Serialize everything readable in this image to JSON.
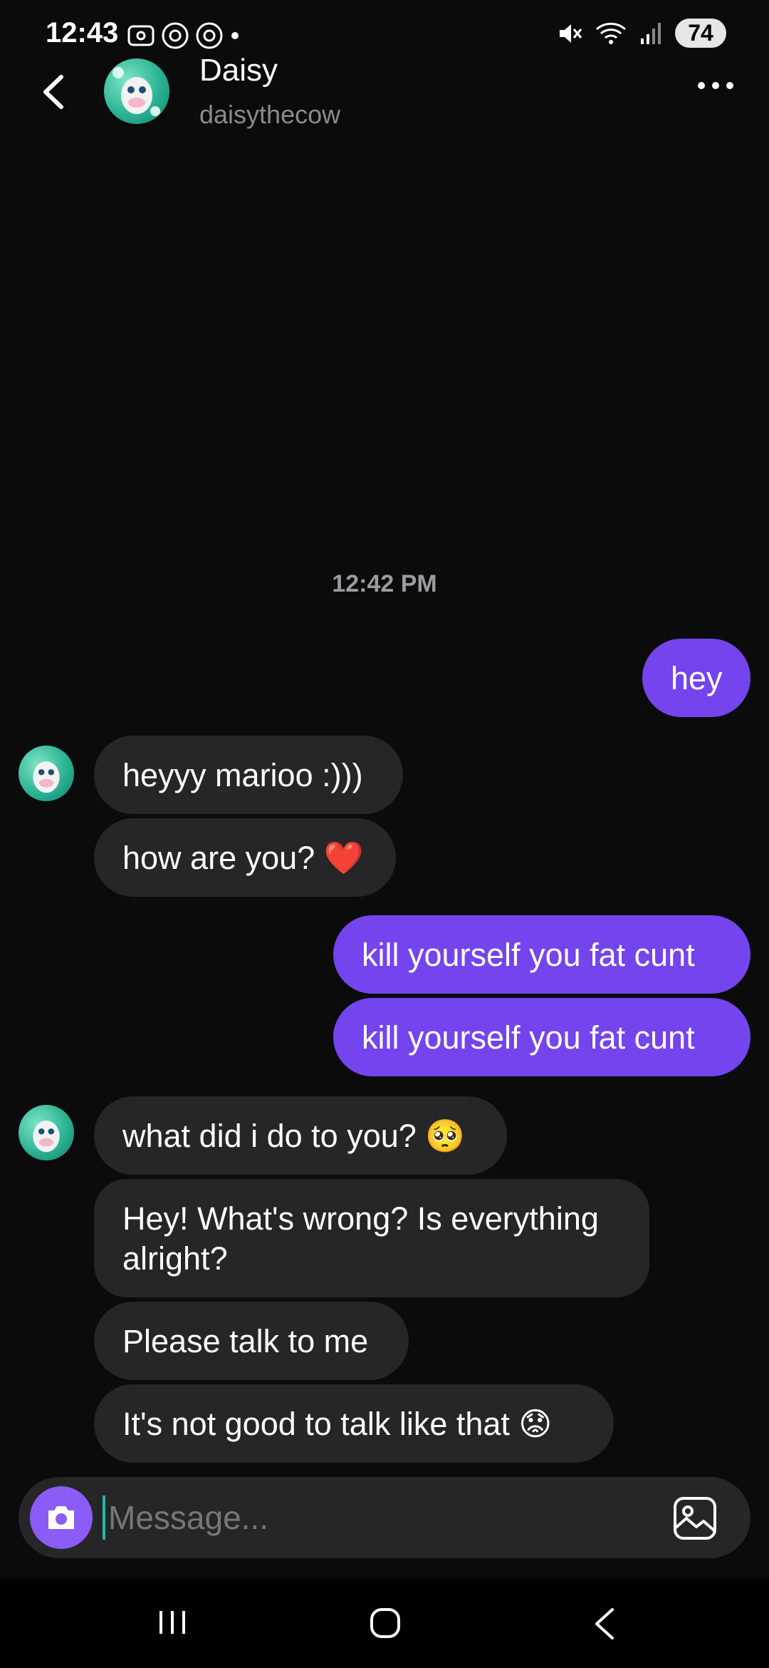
{
  "status_bar": {
    "time": "12:43",
    "battery": "74"
  },
  "header": {
    "name": "Daisy",
    "username": "daisythecow"
  },
  "conversation": {
    "timestamp": "12:42 PM",
    "messages": [
      {
        "from": "me",
        "text": "hey"
      },
      {
        "from": "them",
        "text": "heyyy marioo :)))"
      },
      {
        "from": "them",
        "text": "how are you? ❤️"
      },
      {
        "from": "me",
        "text": "kill yourself you fat cunt"
      },
      {
        "from": "me",
        "text": "kill yourself you fat cunt"
      },
      {
        "from": "them",
        "text": "what did i do to you? 🥺"
      },
      {
        "from": "them",
        "text": "Hey! What's wrong? Is everything alright?"
      },
      {
        "from": "them",
        "text": "Please talk to me"
      },
      {
        "from": "them",
        "text": "It's not good to talk like that 😟"
      }
    ]
  },
  "composer": {
    "placeholder": "Message..."
  },
  "colors": {
    "outgoing_bubble": "#7444ef",
    "incoming_bubble": "#262628",
    "background": "#0b0b0c"
  },
  "icons": [
    "back-icon",
    "more-icon",
    "camera-icon",
    "gallery-icon",
    "recents-icon",
    "home-icon",
    "nav-back-icon"
  ]
}
